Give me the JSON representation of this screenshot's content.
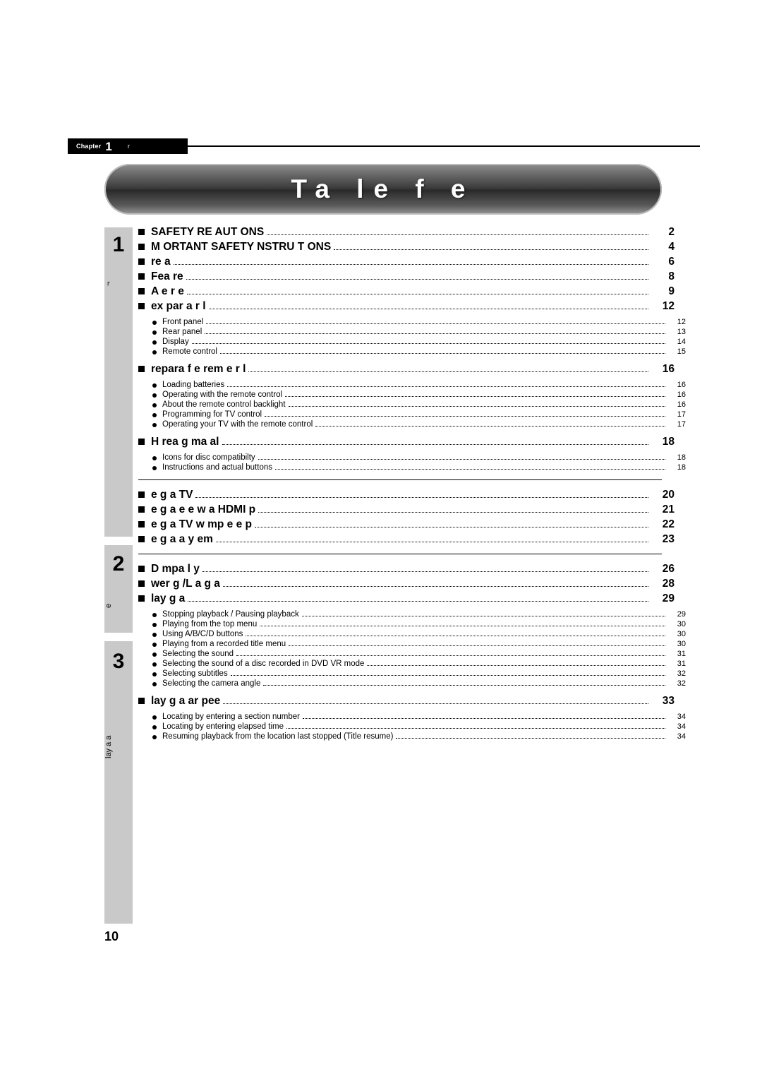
{
  "header": {
    "chapter_word": "Chapter",
    "chapter_number": "1",
    "chapter_sub": "r"
  },
  "banner": {
    "title": "Ta  le  f     e"
  },
  "rails": [
    {
      "number": "1",
      "vtext": "¬"
    },
    {
      "number": "2",
      "vtext": "e"
    },
    {
      "number": "3",
      "vtext": "lay     a            a"
    }
  ],
  "folio": "10",
  "toc": {
    "group1": [
      {
        "level": 1,
        "label": "SAFETY   RE  AUT ONS",
        "page": "2"
      },
      {
        "level": 1,
        "label": "M  ORTANT SAFETY  NSTRU  T ONS",
        "page": "4"
      },
      {
        "level": 1,
        "label": " re  a",
        "page": "6"
      },
      {
        "level": 1,
        "label": "Fea  re",
        "page": "8"
      },
      {
        "level": 1,
        "label": "A   e     r  e",
        "page": "9"
      },
      {
        "level": 1,
        "label": "  ex    par   a          r l",
        "page": "12"
      },
      {
        "level": 2,
        "label": "Front panel",
        "page": "12"
      },
      {
        "level": 2,
        "label": "Rear panel",
        "page": "13"
      },
      {
        "level": 2,
        "label": "Display",
        "page": "14"
      },
      {
        "level": 2,
        "label": "Remote control",
        "page": "15"
      },
      {
        "level": 1,
        "label": " repara        f   e rem  e        r l",
        "page": "16"
      },
      {
        "level": 2,
        "label": "Loading batteries",
        "page": "16"
      },
      {
        "level": 2,
        "label": "Operating with the remote control",
        "page": "16"
      },
      {
        "level": 2,
        "label": "About the remote control backlight",
        "page": "16"
      },
      {
        "level": 2,
        "label": "Programming for TV control",
        "page": "17"
      },
      {
        "level": 2,
        "label": "Operating your TV with the remote control",
        "page": "17"
      },
      {
        "level": 1,
        "label": "H          rea    g      ma     al",
        "page": "18"
      },
      {
        "level": 2,
        "label": "Icons for disc compatibilty",
        "page": "18"
      },
      {
        "level": 2,
        "label": "Instructions and actual buttons",
        "page": "18"
      }
    ],
    "group2": [
      {
        "level": 1,
        "label": "    e       g     a TV",
        "page": "20"
      },
      {
        "level": 1,
        "label": "    e       g      a  e     e w      a  HDMI    p",
        "page": "21"
      },
      {
        "level": 1,
        "label": "    e       g     a TV w     mp   e       e     p",
        "page": "22"
      },
      {
        "level": 1,
        "label": "    e       g     a  a      y  em",
        "page": "23"
      }
    ],
    "group3": [
      {
        "level": 1,
        "label": "D       mpa      l  y",
        "page": "26"
      },
      {
        "level": 1,
        "label": "  wer   g     /L  a   g  a",
        "page": "28"
      },
      {
        "level": 1,
        "label": "  lay   g a",
        "page": "29"
      },
      {
        "level": 2,
        "label": "Stopping playback / Pausing playback",
        "page": "29"
      },
      {
        "level": 2,
        "label": "Playing from the top menu",
        "page": "30"
      },
      {
        "level": 2,
        "label": "Using A/B/C/D buttons",
        "page": "30"
      },
      {
        "level": 2,
        "label": "Playing from a recorded title menu",
        "page": "30"
      },
      {
        "level": 2,
        "label": "Selecting the sound",
        "page": "31"
      },
      {
        "level": 2,
        "label": "Selecting the sound of a disc recorded in DVD VR mode",
        "page": "31"
      },
      {
        "level": 2,
        "label": "Selecting subtitles",
        "page": "32"
      },
      {
        "level": 2,
        "label": "Selecting the camera angle",
        "page": "32"
      },
      {
        "level": 1,
        "label": "  lay   g a  ar        pee",
        "page": "33"
      },
      {
        "level": 2,
        "label": "Locating by entering a section number",
        "page": "34"
      },
      {
        "level": 2,
        "label": "Locating by entering elapsed time",
        "page": "34"
      },
      {
        "level": 2,
        "label": "Resuming playback from the location last stopped (Title resume)",
        "page": "34"
      }
    ]
  }
}
